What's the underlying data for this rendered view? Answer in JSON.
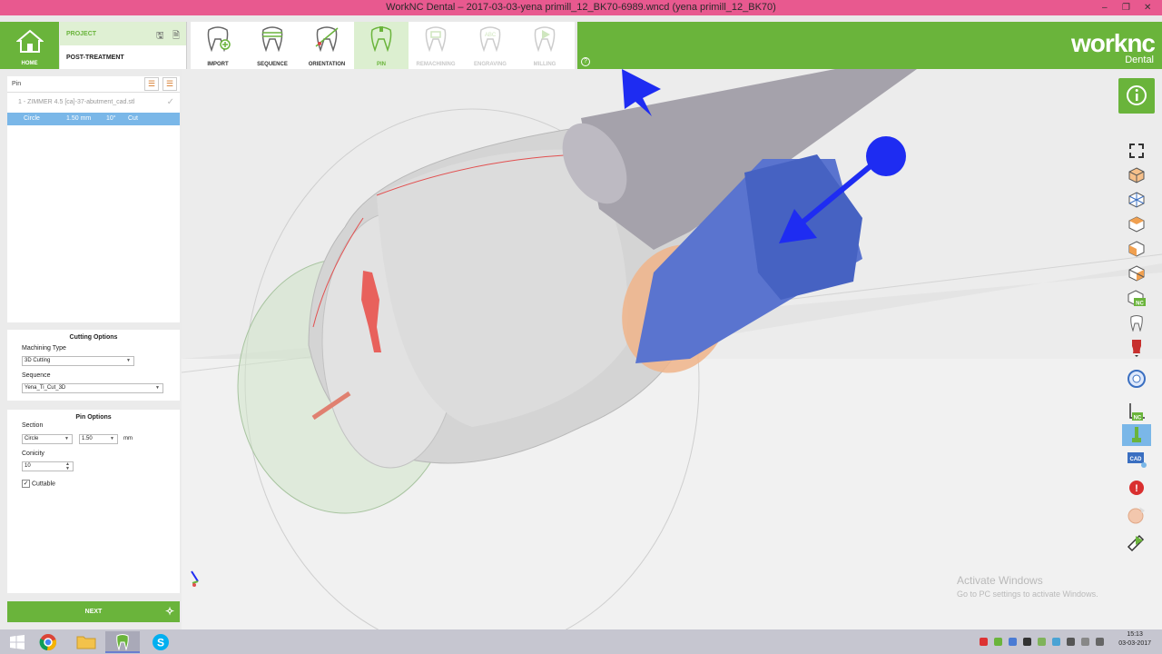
{
  "window": {
    "title": "WorkNC Dental – 2017-03-03-yena primill_12_BK70-6989.wncd (yena primill_12_BK70)"
  },
  "header": {
    "home_label": "HOME",
    "project_label": "PROJECT",
    "post_treatment_label": "POST-TREATMENT",
    "steps": [
      {
        "label": "IMPORT",
        "icon": "import-tooth-icon"
      },
      {
        "label": "SEQUENCE",
        "icon": "sequence-tooth-icon"
      },
      {
        "label": "ORIENTATION",
        "icon": "orientation-tooth-icon"
      },
      {
        "label": "PIN",
        "icon": "pin-tooth-icon"
      },
      {
        "label": "REMACHINING",
        "icon": "remachining-tooth-icon"
      },
      {
        "label": "ENGRAVING",
        "icon": "engraving-tooth-icon"
      },
      {
        "label": "MILLING",
        "icon": "milling-tooth-icon"
      }
    ],
    "engraving_icon_text": "ABC",
    "brand": "worknc",
    "brand_sub": "Dental"
  },
  "pin_panel": {
    "header": "Pin",
    "file": "1 - ZIMMER 4.5 [ca]-37-abutment_cad.stl",
    "selected_row": {
      "section": "Circle",
      "size": "1.50 mm",
      "angle": "10°",
      "mode": "Cut"
    }
  },
  "cutting_options": {
    "title": "Cutting Options",
    "machining_type_label": "Machining Type",
    "machining_type_value": "3D Cutting",
    "sequence_label": "Sequence",
    "sequence_value": "Yena_Ti_Cut_3D"
  },
  "pin_options": {
    "title": "Pin Options",
    "section_label": "Section",
    "section_value": "Circle",
    "diameter_value": "1.50",
    "unit": "mm",
    "conicity_label": "Conicity",
    "conicity_value": "10",
    "cuttable_label": "Cuttable",
    "cuttable_checked": true
  },
  "next_button": "NEXT",
  "right_toolbar_icons": [
    "fit-view-icon",
    "iso-view-icon",
    "wireframe-view-icon",
    "top-view-icon",
    "front-view-icon",
    "side-view-icon",
    "nc-view-icon",
    "tooth-display-icon",
    "pin-color-icon",
    "ring-display-icon",
    "axis-nc-icon",
    "tool-display-icon",
    "cad-display-icon",
    "alert-icon",
    "stock-display-icon",
    "simulation-icon"
  ],
  "right_toolbar_labels": {
    "nc": "NC",
    "cad": "CAD",
    "alert": "!"
  },
  "watermark": {
    "line1": "Activate Windows",
    "line2": "Go to PC settings to activate Windows."
  },
  "taskbar": {
    "time": "15:13",
    "date": "03-03-2017",
    "skype_letter": "S"
  },
  "colors": {
    "brand_green": "#6ab43b",
    "selection_blue": "#7ab7e8",
    "titlebar_pink": "#e8598f"
  }
}
